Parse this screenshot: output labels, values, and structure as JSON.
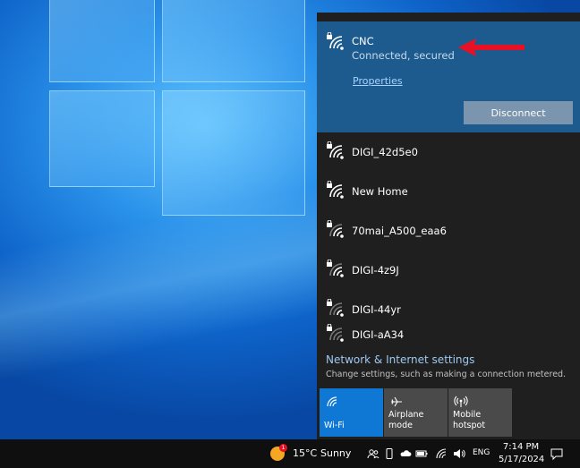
{
  "connected": {
    "name": "CNC",
    "status": "Connected, secured",
    "properties_label": "Properties",
    "disconnect_label": "Disconnect"
  },
  "networks": [
    {
      "name": "DIGI_42d5e0"
    },
    {
      "name": "New Home"
    },
    {
      "name": "70mai_A500_eaa6"
    },
    {
      "name": "DIGI-4z9J"
    },
    {
      "name": "DIGI-44yr"
    },
    {
      "name": "DIGI-aA34"
    }
  ],
  "settings": {
    "title": "Network & Internet settings",
    "description": "Change settings, such as making a connection metered."
  },
  "quick_actions": {
    "wifi": "Wi-Fi",
    "airplane": "Airplane mode",
    "hotspot": "Mobile hotspot"
  },
  "taskbar": {
    "weather_badge": "1",
    "temperature": "15°C",
    "condition": "Sunny",
    "language": "ENG",
    "time": "7:14 PM",
    "date": "5/17/2024"
  },
  "colors": {
    "accent": "#0e78d4",
    "connected_bg": "#1d5b8f",
    "flyout_bg": "#1f1f1f",
    "arrow": "#e81123"
  }
}
